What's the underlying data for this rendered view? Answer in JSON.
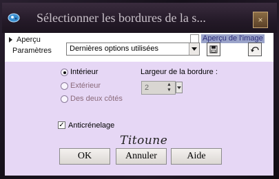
{
  "window": {
    "title": "Sélectionner les bordures de la s...",
    "close_glyph": "×"
  },
  "top": {
    "apercu_label": "Aperçu",
    "params_label": "Paramètres",
    "preview_check_label": "Aperçu de l'image",
    "preset_value": "Dernières options utilisées"
  },
  "options": {
    "radios": [
      {
        "label": "Intérieur",
        "selected": true
      },
      {
        "label": "Extérieur",
        "selected": false
      },
      {
        "label": "Des deux côtés",
        "selected": false
      }
    ],
    "width_label": "Largeur de la bordure :",
    "width_value": "2",
    "antialias_label": "Anticrénelage",
    "antialias_checked": true
  },
  "signature": "Titoune",
  "buttons": {
    "ok": "OK",
    "cancel": "Annuler",
    "help": "Aide"
  },
  "colors": {
    "client": "#e6d7f5",
    "title_text": "#c9c1c9"
  }
}
